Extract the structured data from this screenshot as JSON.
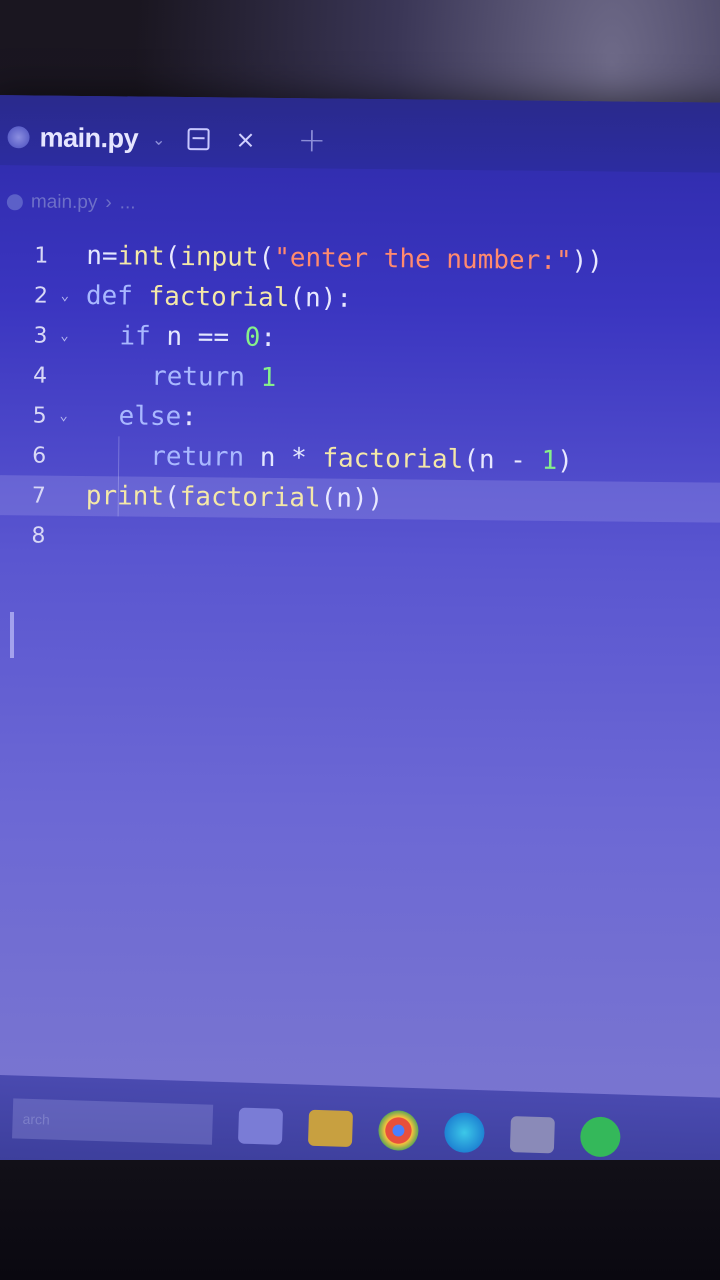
{
  "tab": {
    "title": "main.py"
  },
  "breadcrumb": {
    "file": "main.py",
    "more": "..."
  },
  "editor": {
    "lines": [
      {
        "number": "1",
        "foldable": false
      },
      {
        "number": "2",
        "foldable": true
      },
      {
        "number": "3",
        "foldable": true
      },
      {
        "number": "4",
        "foldable": false
      },
      {
        "number": "5",
        "foldable": true
      },
      {
        "number": "6",
        "foldable": false
      },
      {
        "number": "7",
        "foldable": false
      },
      {
        "number": "8",
        "foldable": false
      }
    ],
    "active_line": "7",
    "code": {
      "l1": {
        "a": "n=",
        "b": "int",
        "c": "(",
        "d": "input",
        "e": "(",
        "f": "\"enter the number:\"",
        "g": "))"
      },
      "l2": {
        "a": "def ",
        "b": "factorial",
        "c": "(n):"
      },
      "l3": {
        "a": "if ",
        "b": "n == ",
        "c": "0",
        "d": ":"
      },
      "l4": {
        "a": "return ",
        "b": "1"
      },
      "l5": {
        "a": "else",
        "b": ":"
      },
      "l6": {
        "a": "return ",
        "b": "n * ",
        "c": "factorial",
        "d": "(n - ",
        "e": "1",
        "f": ")"
      },
      "l7": {
        "a": "print",
        "b": "(",
        "c": "factorial",
        "d": "(n))"
      },
      "l8": {}
    }
  },
  "taskbar": {
    "search_text": "arch"
  },
  "colors": {
    "keyword": "#a9b8ff",
    "function": "#f4e8a8",
    "string": "#ff8a6e",
    "number": "#86f08a",
    "background": "#3a35c0"
  },
  "icons": [
    "python-file-icon",
    "split-editor-icon",
    "close-icon",
    "add-tab-icon",
    "task-view-icon",
    "file-explorer-icon",
    "chrome-icon",
    "edge-icon",
    "store-icon",
    "spotify-icon"
  ]
}
